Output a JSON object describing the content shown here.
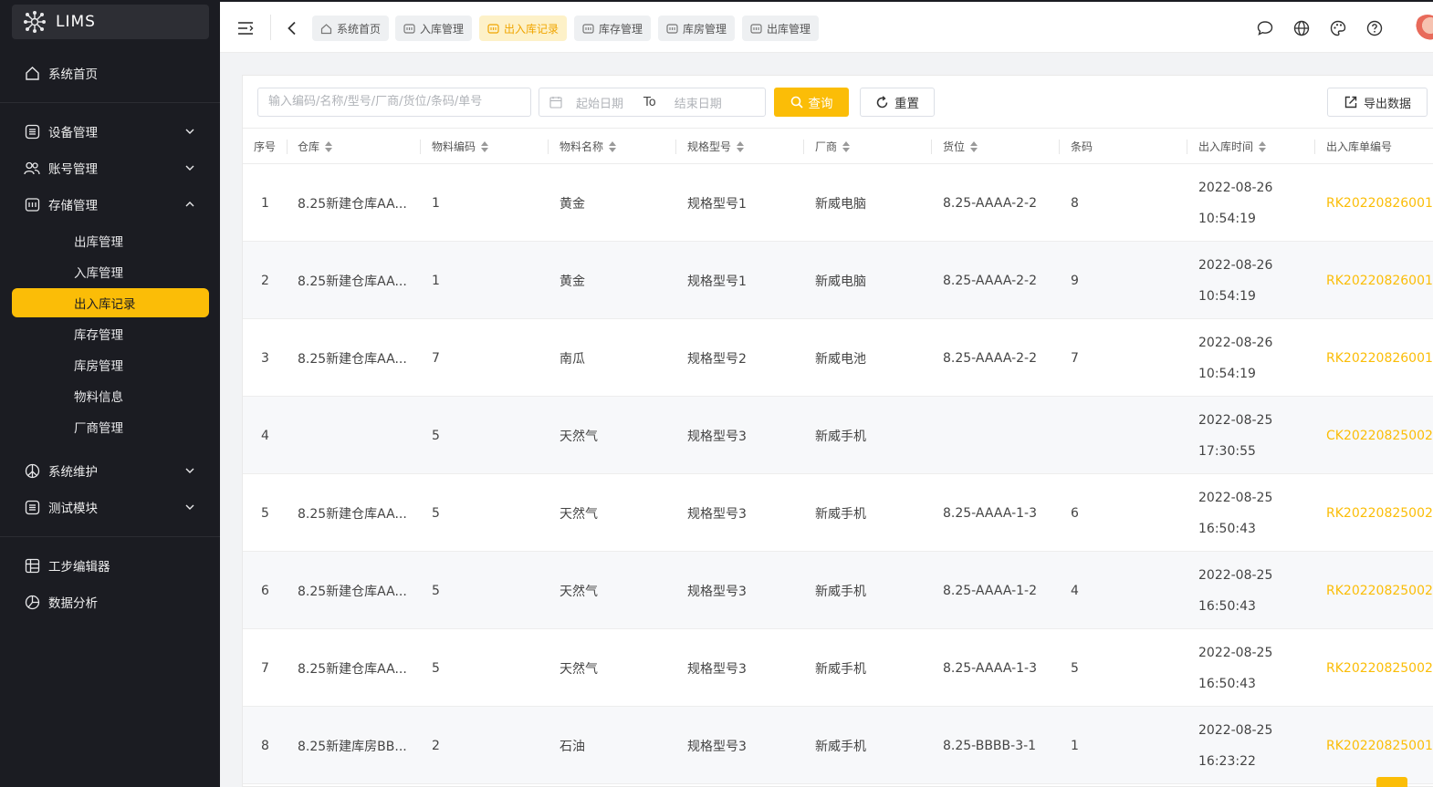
{
  "app": {
    "logo_text": "LIMS"
  },
  "sidebar": {
    "home": "系统首页",
    "groups": [
      {
        "label": "设备管理",
        "icon": "list-icon"
      },
      {
        "label": "账号管理",
        "icon": "users-icon"
      },
      {
        "label": "存储管理",
        "icon": "storage-icon"
      },
      {
        "label": "系统维护",
        "icon": "peace-icon"
      },
      {
        "label": "测试模块",
        "icon": "list-icon"
      },
      {
        "label": "工步编辑器",
        "icon": "grid-icon"
      },
      {
        "label": "数据分析",
        "icon": "pie-icon"
      }
    ],
    "sub_items": [
      "出库管理",
      "入库管理",
      "出入库记录",
      "库存管理",
      "库房管理",
      "物料信息",
      "厂商管理"
    ],
    "active_sub": "出入库记录"
  },
  "tabs": [
    {
      "label": "系统首页",
      "icon": "home-icon",
      "active": false
    },
    {
      "label": "入库管理",
      "icon": "module-icon",
      "active": false
    },
    {
      "label": "出入库记录",
      "icon": "module-icon",
      "active": true
    },
    {
      "label": "库存管理",
      "icon": "module-icon",
      "active": false
    },
    {
      "label": "库房管理",
      "icon": "module-icon",
      "active": false
    },
    {
      "label": "出库管理",
      "icon": "module-icon",
      "active": false
    }
  ],
  "filters": {
    "search_placeholder": "输入编码/名称/型号/厂商/货位/条码/单号",
    "start_placeholder": "起始日期",
    "to_label": "To",
    "end_placeholder": "结束日期",
    "query_label": "查询",
    "reset_label": "重置",
    "export_label": "导出数据"
  },
  "table": {
    "columns": [
      "序号",
      "仓库",
      "物料编码",
      "物料名称",
      "规格型号",
      "厂商",
      "货位",
      "条码",
      "出入库时间",
      "出入库单编号"
    ],
    "rows": [
      [
        "1",
        "8.25新建仓库AA...",
        "1",
        "黄金",
        "规格型号1",
        "新威电脑",
        "8.25-AAAA-2-2",
        "8",
        "2022-08-26 10:54:19",
        "RK20220826001"
      ],
      [
        "2",
        "8.25新建仓库AA...",
        "1",
        "黄金",
        "规格型号1",
        "新威电脑",
        "8.25-AAAA-2-2",
        "9",
        "2022-08-26 10:54:19",
        "RK20220826001"
      ],
      [
        "3",
        "8.25新建仓库AA...",
        "7",
        "南瓜",
        "规格型号2",
        "新威电池",
        "8.25-AAAA-2-2",
        "7",
        "2022-08-26 10:54:19",
        "RK20220826001"
      ],
      [
        "4",
        "",
        "5",
        "天然气",
        "规格型号3",
        "新威手机",
        "",
        "",
        "2022-08-25 17:30:55",
        "CK20220825002"
      ],
      [
        "5",
        "8.25新建仓库AA...",
        "5",
        "天然气",
        "规格型号3",
        "新威手机",
        "8.25-AAAA-1-3",
        "6",
        "2022-08-25 16:50:43",
        "RK20220825002"
      ],
      [
        "6",
        "8.25新建仓库AA...",
        "5",
        "天然气",
        "规格型号3",
        "新威手机",
        "8.25-AAAA-1-2",
        "4",
        "2022-08-25 16:50:43",
        "RK20220825002"
      ],
      [
        "7",
        "8.25新建仓库AA...",
        "5",
        "天然气",
        "规格型号3",
        "新威手机",
        "8.25-AAAA-1-3",
        "5",
        "2022-08-25 16:50:43",
        "RK20220825002"
      ],
      [
        "8",
        "8.25新建库房BB...",
        "2",
        "石油",
        "规格型号3",
        "新威手机",
        "8.25-BBBB-3-1",
        "1",
        "2022-08-25 16:23:22",
        "RK20220825001"
      ]
    ]
  },
  "colors": {
    "accent": "#fbbd07",
    "sidebar_bg": "#1b1c22"
  }
}
